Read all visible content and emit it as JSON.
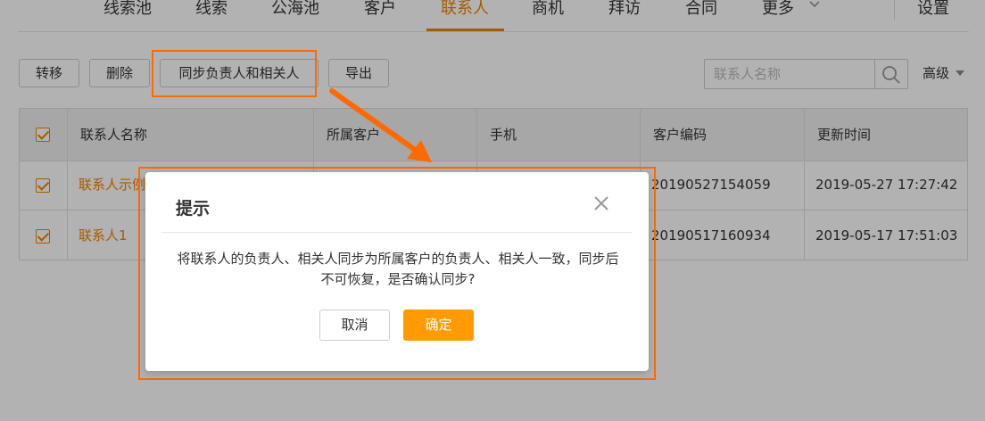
{
  "nav": {
    "items": [
      "线索池",
      "线索",
      "公海池",
      "客户",
      "联系人",
      "商机",
      "拜访",
      "合同",
      "更多"
    ],
    "settings": "设置"
  },
  "toolbar": {
    "transfer": "转移",
    "delete": "删除",
    "sync": "同步负责人和相关人",
    "export": "导出",
    "search_placeholder": "联系人名称",
    "advanced": "高级"
  },
  "table": {
    "columns": [
      "联系人名称",
      "所属客户",
      "手机",
      "客户编码",
      "更新时间"
    ],
    "rows": [
      {
        "name": "联系人示例",
        "customer": "",
        "phone": "",
        "code": "20190527154059",
        "updated": "2019-05-27 17:27:42"
      },
      {
        "name": "联系人1",
        "customer": "",
        "phone": "",
        "code": "20190517160934",
        "updated": "2019-05-17 17:51:03"
      }
    ]
  },
  "dialog": {
    "title": "提示",
    "message_line1": "将联系人的负责人、相关人同步为所属客户的负责人、相关人一致，同步后",
    "message_line2": "不可恢复，是否确认同步?",
    "cancel": "取消",
    "confirm": "确定"
  },
  "colors": {
    "accent": "#f08200",
    "confirm": "#ff9a00",
    "annotation": "#ff6a00"
  }
}
